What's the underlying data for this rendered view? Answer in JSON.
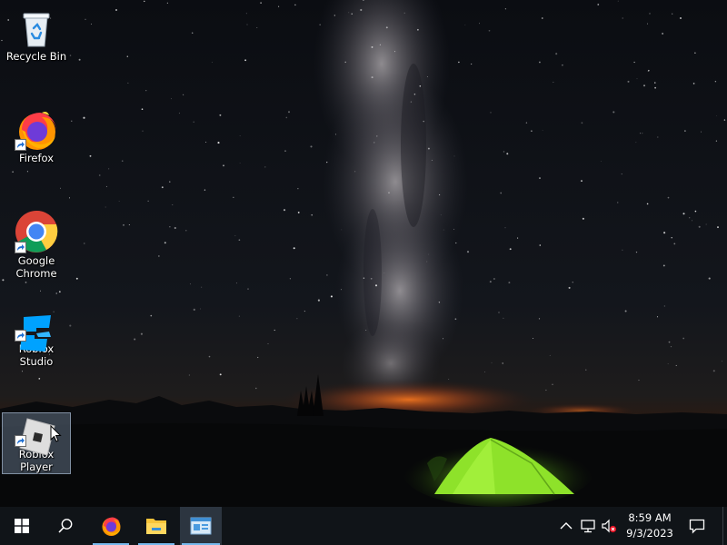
{
  "desktop": {
    "icons": [
      {
        "label": "Recycle Bin",
        "icon": "recycle-bin-icon"
      },
      {
        "label": "Firefox",
        "icon": "firefox-icon"
      },
      {
        "label": "Google Chrome",
        "icon": "chrome-icon"
      },
      {
        "label": "Roblox Studio",
        "icon": "roblox-studio-icon"
      },
      {
        "label": "Roblox Player",
        "icon": "roblox-player-icon"
      }
    ]
  },
  "taskbar": {
    "pinned": [
      {
        "icon": "windows-start-icon"
      },
      {
        "icon": "search-icon"
      },
      {
        "icon": "firefox-icon"
      },
      {
        "icon": "file-explorer-icon"
      },
      {
        "icon": "control-panel-icon"
      }
    ],
    "tray": {
      "icons": [
        "chevron-up-icon",
        "network-icon",
        "volume-muted-icon"
      ],
      "time": "8:59 AM",
      "date": "9/3/2023"
    },
    "notification_icon": "notification-icon"
  },
  "colors": {
    "taskbar": "#101418",
    "accent": "#76b9ed",
    "tent": "#8ee22a",
    "horizon_glow": "#e0641e"
  }
}
